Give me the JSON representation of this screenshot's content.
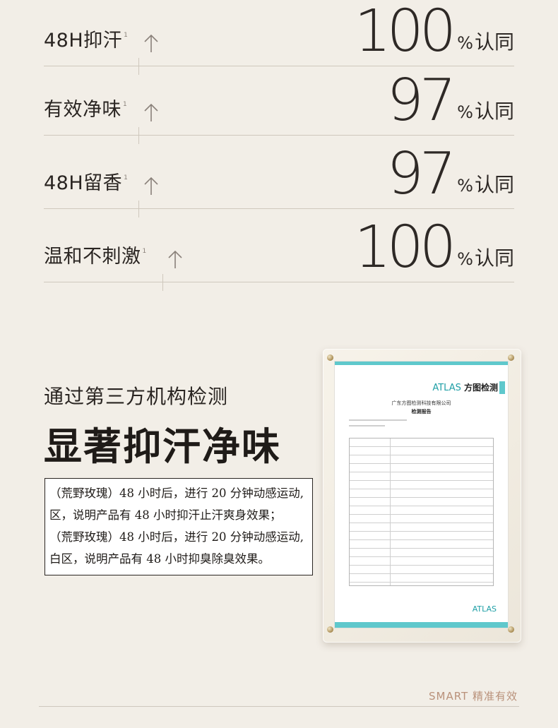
{
  "stats": [
    {
      "label": "48H抑汗",
      "sup": "1",
      "value": "100",
      "pct": "%",
      "unit": "认同"
    },
    {
      "label": "有效净味",
      "sup": "1",
      "value": "97",
      "pct": "%",
      "unit": "认同"
    },
    {
      "label": "48H留香",
      "sup": "1",
      "value": "97",
      "pct": "%",
      "unit": "认同"
    },
    {
      "label": "温和不刺激",
      "sup": "1",
      "value": "100",
      "pct": "%",
      "unit": "认同"
    }
  ],
  "section": {
    "subtitle": "通过第三方机构检测",
    "title": "显著抑汗净味"
  },
  "note": {
    "lines": [
      "（荒野玫瑰）48 小时后，进行 20 分钟动感运动,",
      "区，说明产品有 48 小时抑汗止汗爽身效果；",
      "（荒野玫瑰）48 小时后，进行 20 分钟动感运动,",
      "白区，说明产品有 48 小时抑臭除臭效果。"
    ]
  },
  "certificate": {
    "brand": "ATLAS",
    "brand_cn": "方图检测",
    "org": "广东方图检测科技有限公司",
    "doc_title": "检测报告",
    "footer_brand": "ATLAS"
  },
  "footer": {
    "slogan": "SMART 精准有效"
  },
  "colors": {
    "background": "#f2eee7",
    "accent_teal": "#5fc8cc",
    "slogan": "#b9917a"
  }
}
